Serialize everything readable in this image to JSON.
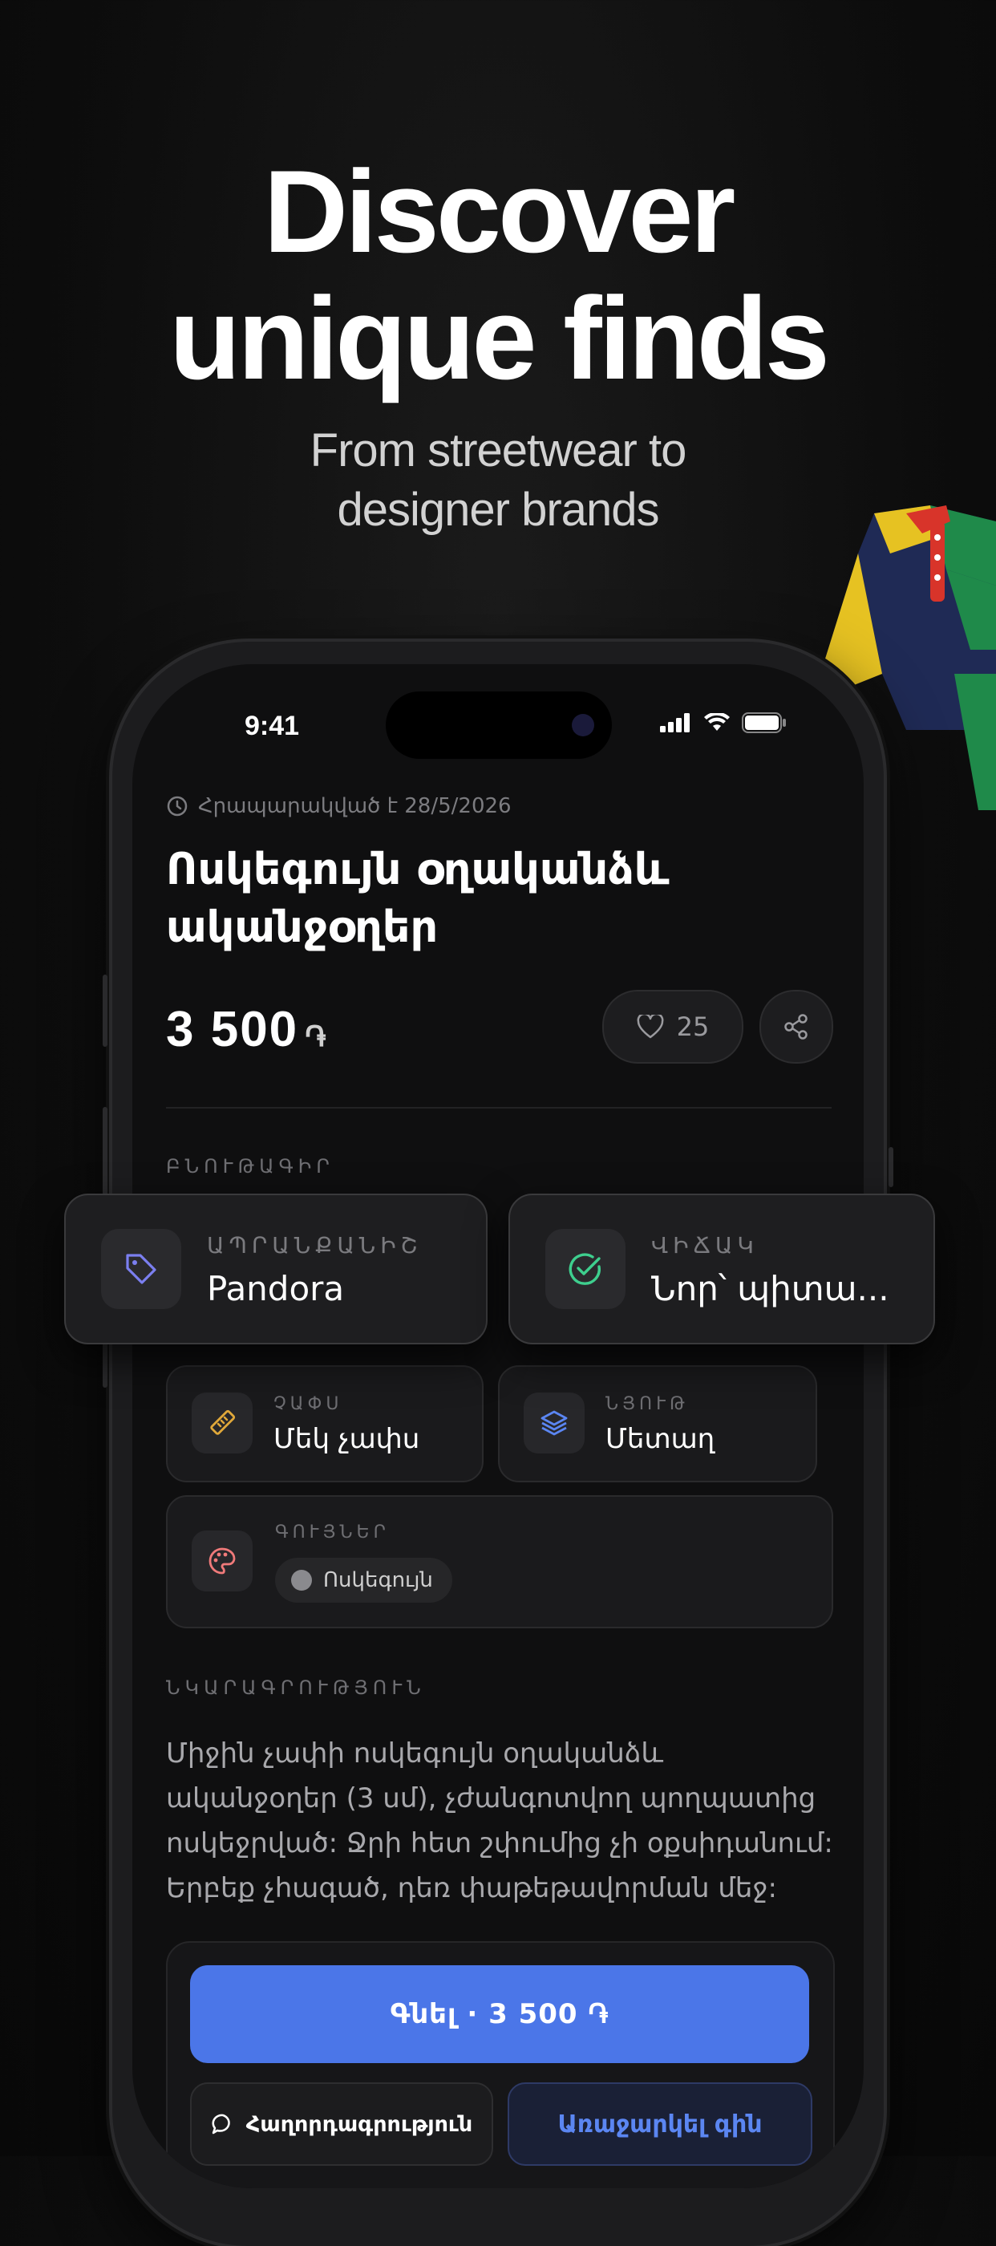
{
  "hero": {
    "headline_line1": "Discover",
    "headline_line2": "unique finds",
    "subhead_line1": "From streetwear to",
    "subhead_line2": "designer brands"
  },
  "status_bar": {
    "time": "9:41"
  },
  "listing": {
    "posted_text": "Հրապարակված է 28/5/2026",
    "title": "Ոսկեգույն օղականձև ականջօղեր",
    "price": "3 500",
    "currency": "֏",
    "likes": "25",
    "characteristics_label": "ԲՆՈՒԹԱԳԻՐ",
    "brand_label": "ԱՊՐԱՆՔԱՆԻՇ",
    "brand_value": "Pandora",
    "condition_label": "ՎԻՃԱԿ",
    "condition_value": "Նոր՝ պիտա...",
    "size_label": "ՉԱՓՍ",
    "size_value": "Մեկ չափս",
    "material_label": "ՆՅՈՒԹ",
    "material_value": "Մետաղ",
    "colors_label": "ԳՈՒՅՆԵՐ",
    "color_chip": "Ոսկեգույն",
    "description_label": "ՆԿԱՐԱԳՐՈՒԹՅՈՒՆ",
    "description": "Միջին չափի ոսկեգույն օղականձև ականջօղեր (3 սմ), չժանգոտվող պողպատից ոսկեջրված: Ջրի հետ շփումից չի օքսիդանում: Երբեք չհագած, դեռ փաթեթավորման մեջ:"
  },
  "actions": {
    "buy_label": "Գնել · 3 500 ֏",
    "message_label": "Հաղորդագրություն",
    "offer_label": "Առաջարկել գին"
  },
  "icons": {
    "clock": "clock-icon",
    "heart": "heart-icon",
    "share": "share-icon",
    "tag": "tag-icon",
    "check": "check-circle-icon",
    "ruler": "ruler-icon",
    "layers": "layers-icon",
    "palette": "palette-icon",
    "chat": "chat-bubble-icon"
  },
  "colors": {
    "accent": "#4b76e8",
    "tag_icon": "#7b7ff0",
    "check_icon": "#3ecf8e",
    "ruler_icon": "#e0a83a",
    "layers_icon": "#5b86f2",
    "palette_icon": "#f07a7a"
  }
}
